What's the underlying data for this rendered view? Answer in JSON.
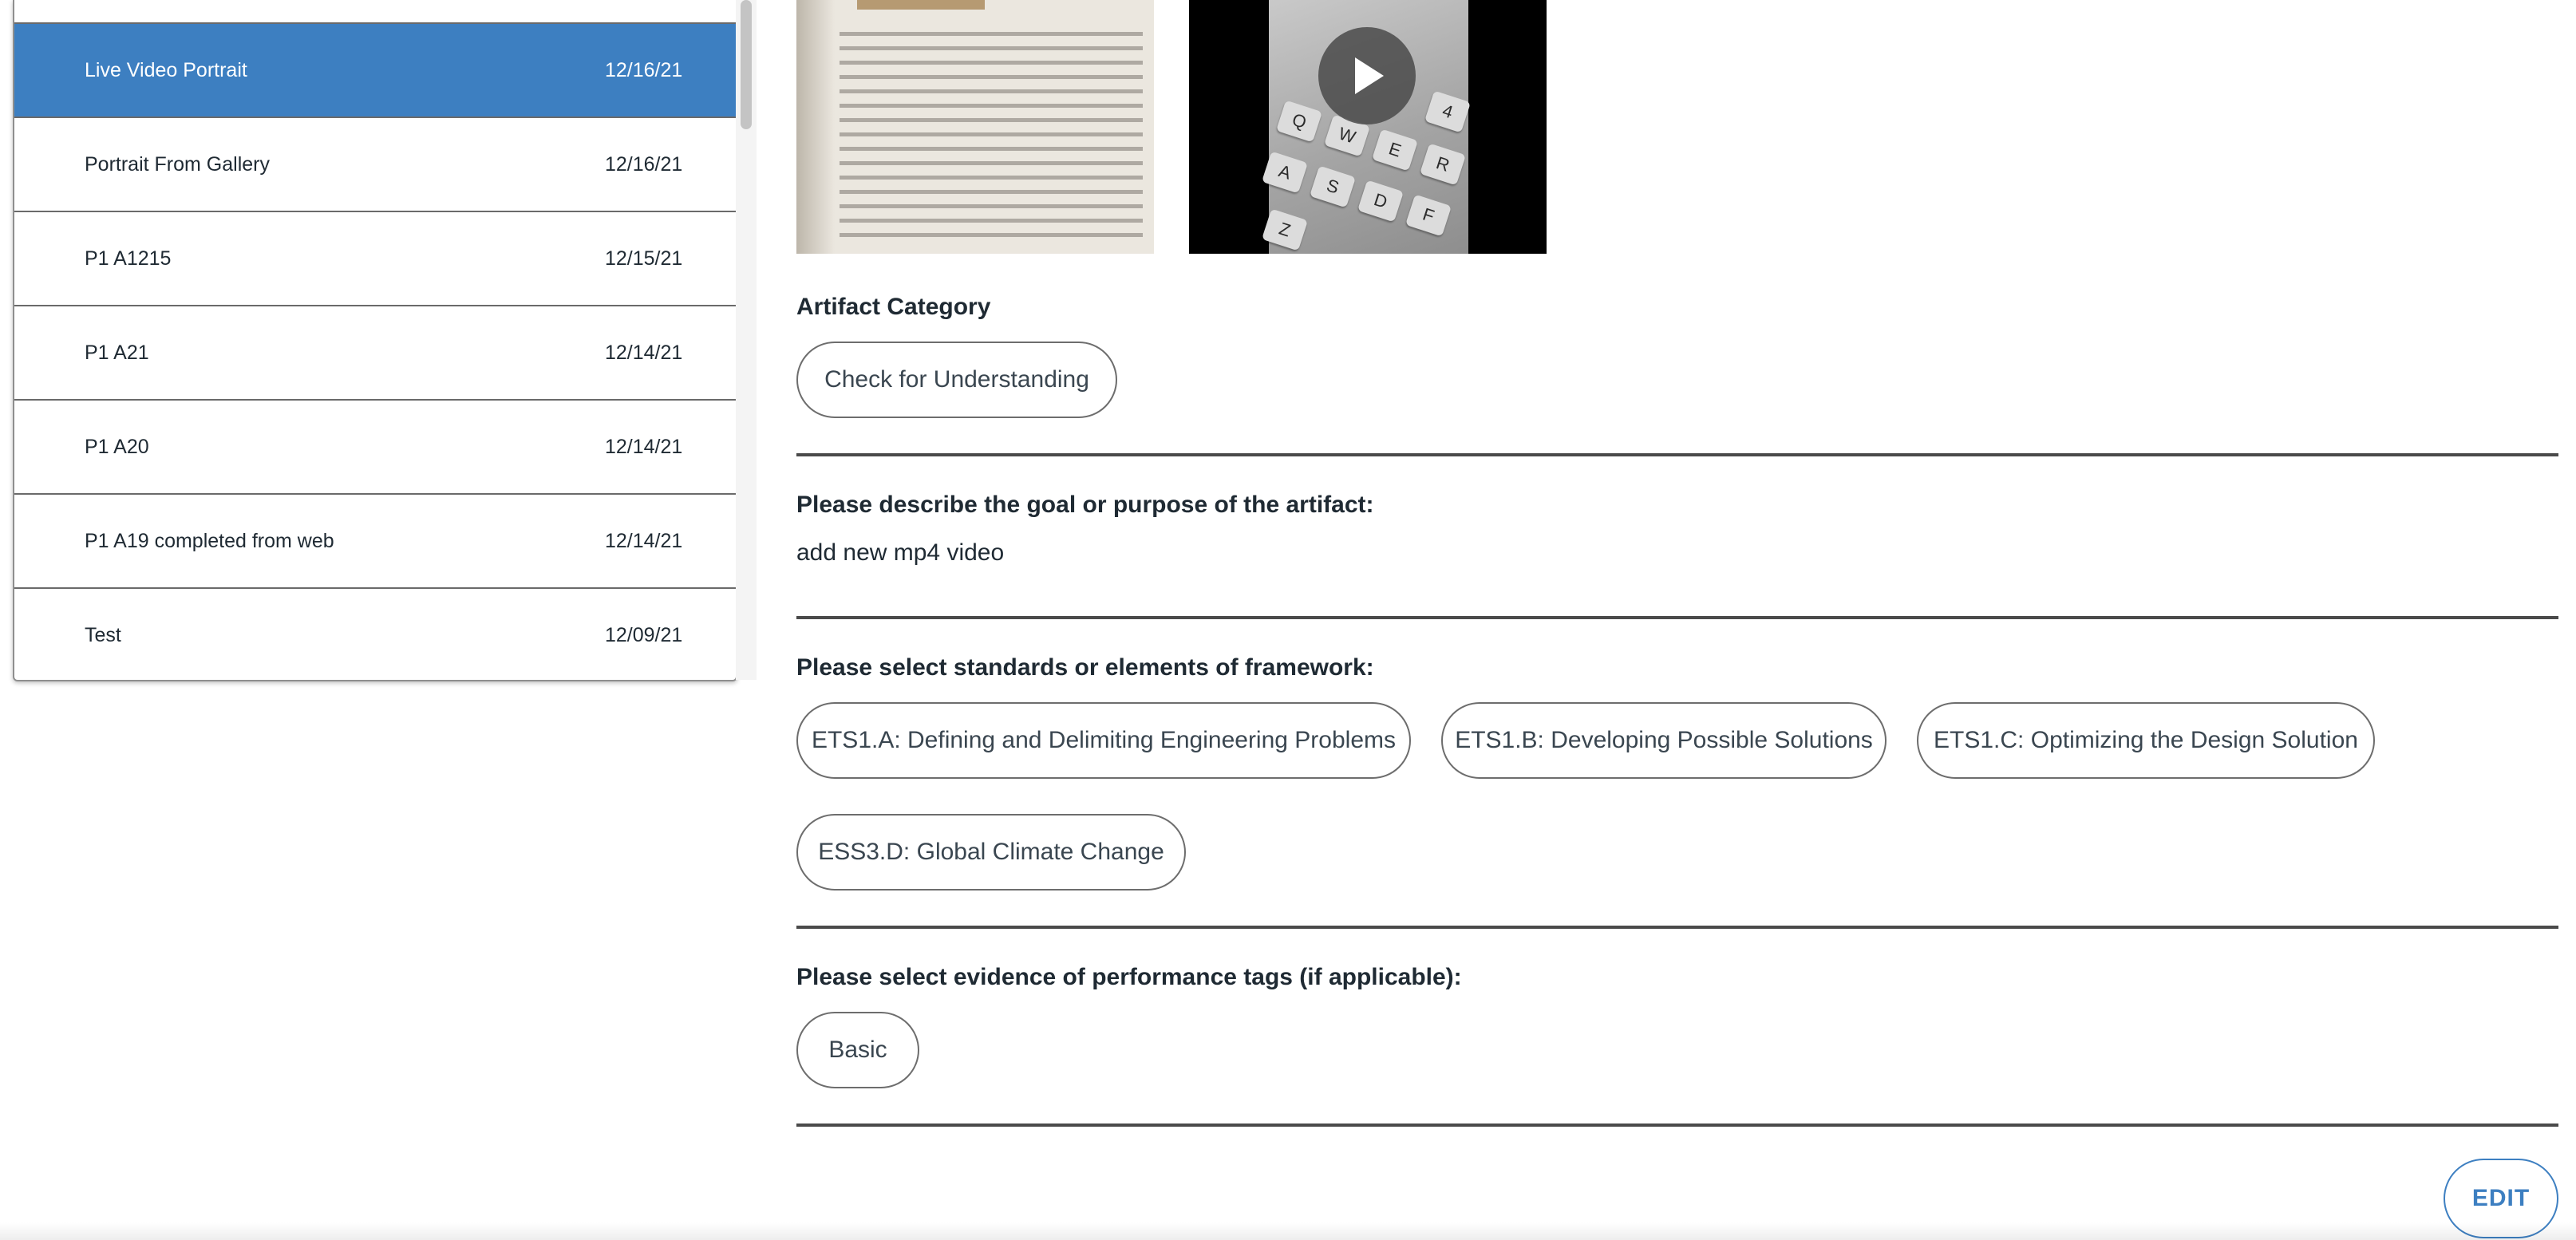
{
  "artifact_list": {
    "items": [
      {
        "title": "Live Video Portrait",
        "date": "12/16/21",
        "selected": true
      },
      {
        "title": "Portrait From Gallery",
        "date": "12/16/21",
        "selected": false
      },
      {
        "title": "P1 A1215",
        "date": "12/15/21",
        "selected": false
      },
      {
        "title": "P1 A21",
        "date": "12/14/21",
        "selected": false
      },
      {
        "title": "P1 A20",
        "date": "12/14/21",
        "selected": false
      },
      {
        "title": "P1 A19 completed from web",
        "date": "12/14/21",
        "selected": false
      },
      {
        "title": "Test",
        "date": "12/09/21",
        "selected": false
      }
    ]
  },
  "media": {
    "video_keys": [
      "Q",
      "W",
      "E",
      "R",
      "4",
      "A",
      "S",
      "D",
      "F",
      "Z"
    ]
  },
  "detail": {
    "category": {
      "label": "Artifact Category",
      "value": "Check for Understanding"
    },
    "goal": {
      "label": "Please describe the goal or purpose of the artifact:",
      "value": "add new mp4 video"
    },
    "standards": {
      "label": "Please select standards or elements of framework:",
      "items": [
        "ETS1.A: Defining and Delimiting Engineering Problems",
        "ETS1.B: Developing Possible Solutions",
        "ETS1.C: Optimizing the Design Solution",
        "ESS3.D: Global Climate Change"
      ]
    },
    "performance": {
      "label": "Please select evidence of performance tags (if applicable):",
      "items": [
        "Basic"
      ]
    },
    "edit_label": "EDIT"
  },
  "colors": {
    "accent": "#3d7fc1",
    "text": "#1f2a33",
    "divider": "#4a4a4a"
  }
}
